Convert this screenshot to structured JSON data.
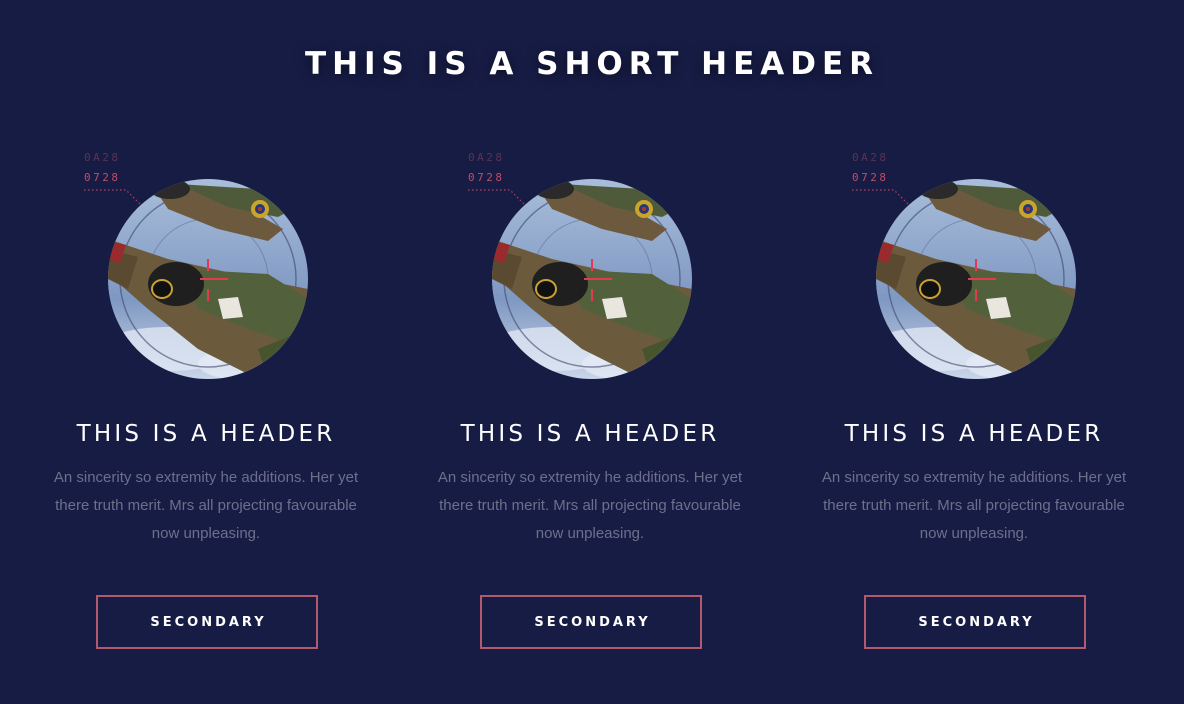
{
  "page": {
    "title": "THIS IS A SHORT HEADER"
  },
  "cards": [
    {
      "readout_top": "0A28",
      "readout_bottom": "0728",
      "title": "THIS IS A HEADER",
      "body": "An sincerity so extremity he additions. Her yet there truth merit. Mrs all projecting favourable now unpleasing.",
      "button_label": "SECONDARY"
    },
    {
      "readout_top": "0A28",
      "readout_bottom": "0728",
      "title": "THIS IS A HEADER",
      "body": "An sincerity so extremity he additions. Her yet there truth merit. Mrs all projecting favourable now unpleasing.",
      "button_label": "SECONDARY"
    },
    {
      "readout_top": "0A28",
      "readout_bottom": "0728",
      "title": "THIS IS A HEADER",
      "body": "An sincerity so extremity he additions. Her yet there truth merit. Mrs all projecting favourable now unpleasing.",
      "button_label": "SECONDARY"
    }
  ],
  "colors": {
    "background": "#171c45",
    "accent": "#b4586e",
    "readout": "#c54a66",
    "body_text": "#6d6f8c"
  }
}
